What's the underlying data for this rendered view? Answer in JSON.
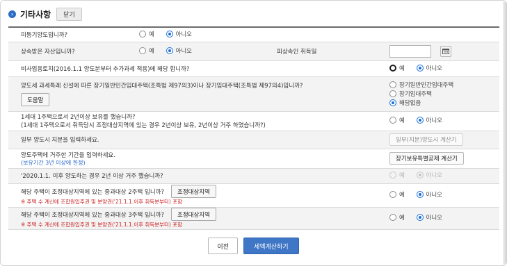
{
  "header": {
    "title": "기타사항",
    "close_label": "닫기"
  },
  "rows": {
    "unregistered": {
      "question": "미등기양도입니까?",
      "opt_yes": "예",
      "opt_no": "아니오"
    },
    "inherited": {
      "question": "상속받은 자산입니까?",
      "opt_yes": "예",
      "opt_no": "아니오",
      "decedent_label": "피상속인 취득일",
      "decedent_date": ""
    },
    "nonbusiness_land": {
      "question": "비사업용토지(2016.1.1 양도분부터 추가과세 적용)에 해당 합니까?",
      "opt_yes": "예",
      "opt_no": "아니오"
    },
    "longterm_rental": {
      "question": "양도세 과세특례 신설에 따른 장기일반민간임대주택(조특법 제97의3)이나 장기임대주택(조특법 제97의4)입니까?",
      "help_label": "도움말",
      "options": [
        "장기일반민간임대주택",
        "장기임대주택",
        "해당없음"
      ]
    },
    "one_house": {
      "question": "1세대 1주택으로서 2년이상 보유를 했습니까?",
      "question2": "(1세대 1주택으로서 취득당시 조정대상지역에 있는 경우 2년이상 보유, 2년이상 거주 하였습니까?)",
      "opt_yes": "예",
      "opt_no": "아니오"
    },
    "partial_share": {
      "question": "일부 양도시 지분을 입력하세요.",
      "button_label": "일부(지분)양도시 계산기"
    },
    "residence_period": {
      "question": "양도주택에 거주한 기간을 입력하세요.",
      "note": "(보유기간 3년 이상에 한정)",
      "button_label": "장기보유특별공제 계산기"
    },
    "after_2020": {
      "question": "'2020.1.1. 이후 양도하는 경우 2년 이상 거주 했습니까?",
      "opt_yes": "예",
      "opt_no": "아니오"
    },
    "adjusted_2house": {
      "question": "해당 주택이 조정대상지역에 있는 중과대상 2주택 입니까?",
      "warning": "※ 주택 수 계산에 조합원입주권 및 분양권('21.1.1.이후 취득분부터) 포함",
      "button_label": "조정대상지역",
      "opt_yes": "예",
      "opt_no": "아니오"
    },
    "adjusted_3house": {
      "question": "해당 주택이 조정대상지역에 있는 중과대상 3주택 입니까?",
      "warning": "※ 주택 수 계산에 조합원입주권 및 분양권('21.1.1.이후 취득분부터) 포함",
      "button_label": "조정대상지역",
      "opt_yes": "예",
      "opt_no": "아니오"
    }
  },
  "footer": {
    "prev_label": "이전",
    "submit_label": "세액계산하기"
  },
  "colors": {
    "accent": "#3f77c6",
    "warning": "#cc2222",
    "note": "#2a67c9"
  }
}
